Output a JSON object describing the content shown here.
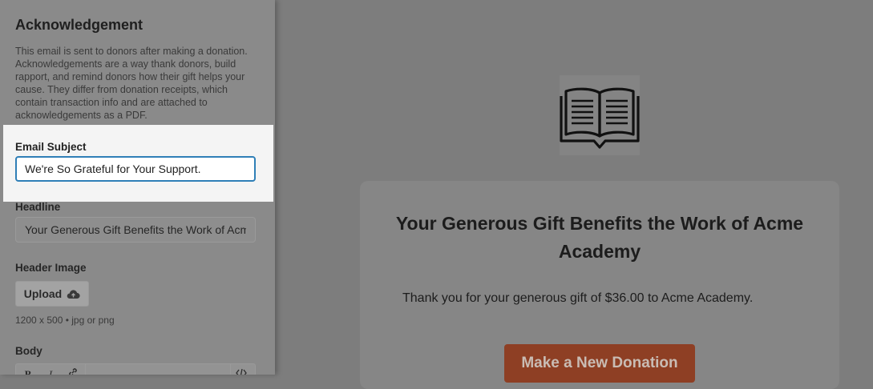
{
  "sidebar": {
    "title": "Acknowledgement",
    "description": "This email is sent to donors after making a donation. Acknowledgements are a way thank donors, build rapport, and remind donors how their gift helps your cause. They differ from donation receipts, which contain transaction info and are attached to acknowledgements as a PDF.",
    "email_subject": {
      "label": "Email Subject",
      "value": "We're So Grateful for Your Support."
    },
    "headline": {
      "label": "Headline",
      "value": "Your Generous Gift Benefits the Work of Acme Academy"
    },
    "header_image": {
      "label": "Header Image",
      "upload_label": "Upload",
      "upload_icon": "cloud-upload-icon",
      "hint": "1200 x 500  •  jpg or png"
    },
    "body": {
      "label": "Body",
      "toolbar": [
        "B",
        "I",
        "link-icon",
        "code-icon"
      ]
    }
  },
  "preview": {
    "logo_icon": "open-book-icon",
    "headline": "Your Generous Gift Benefits the Work of Acme Academy",
    "message": "Thank you for your generous gift of $36.00 to Acme Academy.",
    "button_label": "Make a New Donation",
    "button_color": "#8e3f24"
  }
}
